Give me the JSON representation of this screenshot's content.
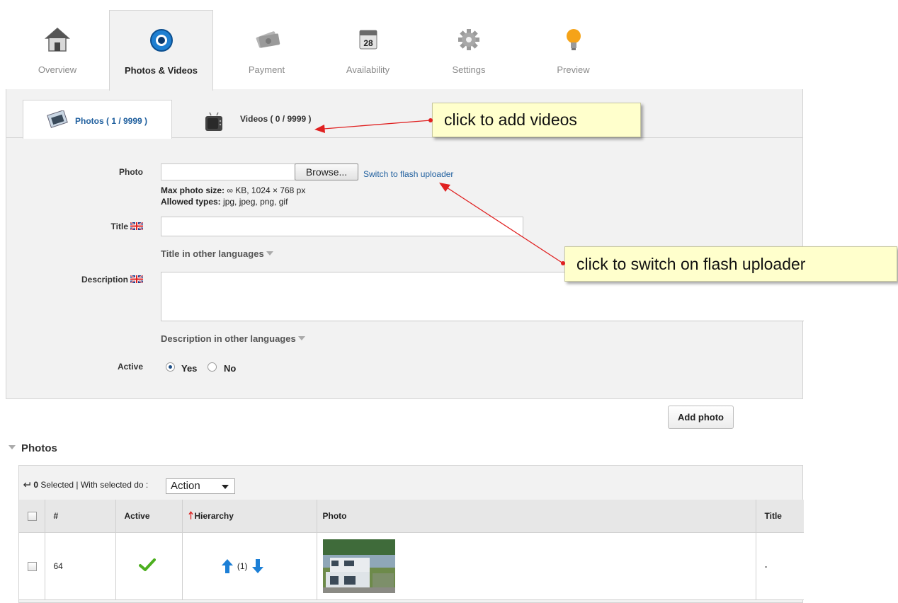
{
  "top_tabs": [
    {
      "label": "Overview",
      "icon": "house-icon",
      "active": false
    },
    {
      "label": "Photos & Videos",
      "icon": "camera-lens-icon",
      "active": true
    },
    {
      "label": "Payment",
      "icon": "money-icon",
      "active": false
    },
    {
      "label": "Availability",
      "icon": "calendar-icon",
      "active": false
    },
    {
      "label": "Settings",
      "icon": "gear-icon",
      "active": false
    },
    {
      "label": "Preview",
      "icon": "lightbulb-icon",
      "active": false
    }
  ],
  "calendar_day": "28",
  "sub_tabs": {
    "photos": {
      "label": "Photos ( 1 / 9999 )",
      "icon": "photo-icon"
    },
    "videos": {
      "label": "Videos ( 0 / 9999 )",
      "icon": "tv-icon"
    }
  },
  "form": {
    "photo_label": "Photo",
    "browse_label": "Browse...",
    "flash_link": "Switch to flash uploader",
    "max_size_label": "Max photo size:",
    "max_size_value": "∞ KB, 1024 × 768 px",
    "allowed_label": "Allowed types:",
    "allowed_value": "jpg, jpeg, png, gif",
    "title_label": "Title",
    "title_value": "",
    "title_other": "Title in other languages",
    "description_label": "Description",
    "description_value": "",
    "description_other": "Description in other languages",
    "active_label": "Active",
    "yes_label": "Yes",
    "no_label": "No",
    "active_selected": "Yes"
  },
  "add_photo_label": "Add photo",
  "photos_section": {
    "title": "Photos",
    "selected_count": "0",
    "selected_text": "Selected | With selected do :",
    "action_value": "Action",
    "columns": [
      "#",
      "Active",
      "Hierarchy",
      "Photo",
      "Title"
    ],
    "rows": [
      {
        "id": "64",
        "active": true,
        "hierarchy": "(1)",
        "title": "-"
      }
    ]
  },
  "callouts": {
    "videos": "click to add videos",
    "flash": "click to switch on flash uploader"
  },
  "colors": {
    "accent_link": "#1f5f9e",
    "callout_bg": "#ffffcc",
    "arrow": "#e02020",
    "panel_bg": "#f2f2f2"
  }
}
